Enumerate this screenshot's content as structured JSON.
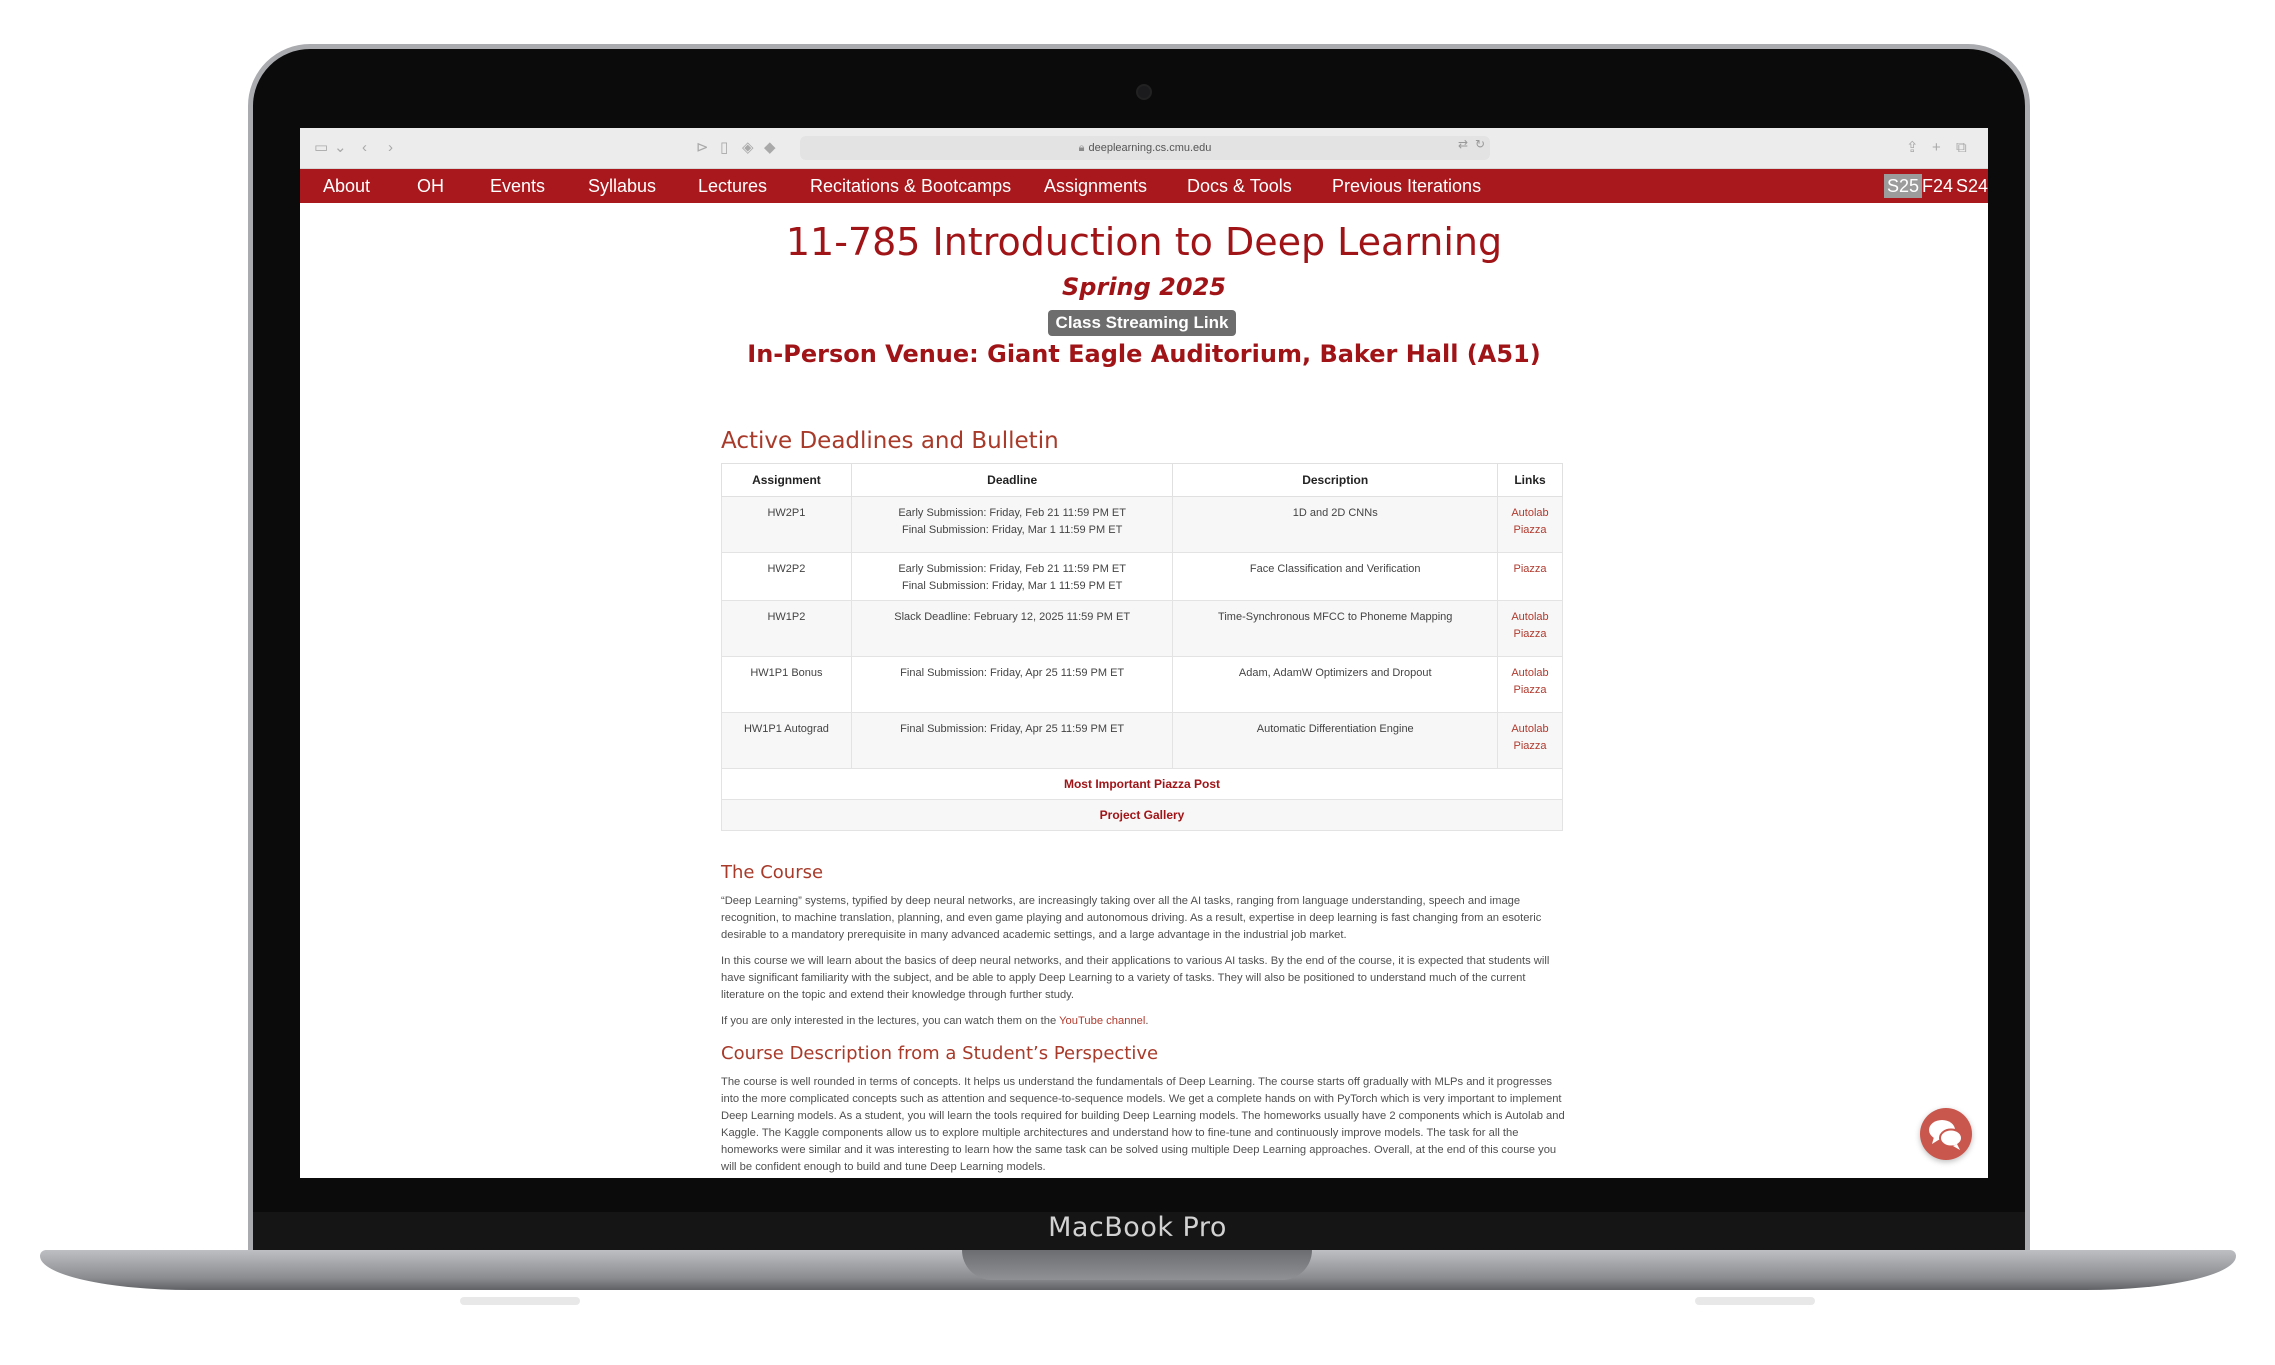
{
  "device": {
    "label": "MacBook Pro"
  },
  "browser": {
    "url": "deeplearning.cs.cmu.edu"
  },
  "nav": {
    "items": [
      "About",
      "OH",
      "Events",
      "Syllabus",
      "Lectures",
      "Recitations & Bootcamps",
      "Assignments",
      "Docs & Tools",
      "Previous Iterations"
    ],
    "terms": [
      "S25",
      "F24",
      "S24"
    ],
    "active_term": "S25"
  },
  "header": {
    "title": "11-785 Introduction to Deep Learning",
    "subtitle": "Spring 2025",
    "stream_button": "Class Streaming Link",
    "venue": "In-Person Venue: Giant Eagle Auditorium, Baker Hall (A51)"
  },
  "deadlines": {
    "heading": "Active Deadlines and Bulletin",
    "columns": [
      "Assignment",
      "Deadline",
      "Description",
      "Links"
    ],
    "rows": [
      {
        "assignment": "HW2P1",
        "deadline": [
          "Early Submission: Friday, Feb 21 11:59 PM ET",
          "Final Submission: Friday, Mar 1 11:59 PM ET"
        ],
        "description": "1D and 2D CNNs",
        "links": [
          "Autolab",
          "Piazza"
        ]
      },
      {
        "assignment": "HW2P2",
        "deadline": [
          "Early Submission: Friday, Feb 21 11:59 PM ET",
          "Final Submission: Friday, Mar 1 11:59 PM ET"
        ],
        "description": "Face Classification and Verification",
        "links": [
          "Piazza"
        ]
      },
      {
        "assignment": "HW1P2",
        "deadline": [
          "Slack Deadline: February 12, 2025 11:59 PM ET"
        ],
        "description": "Time-Synchronous MFCC to Phoneme Mapping",
        "links": [
          "Autolab",
          "Piazza"
        ]
      },
      {
        "assignment": "HW1P1 Bonus",
        "deadline": [
          "Final Submission: Friday, Apr 25 11:59 PM ET"
        ],
        "description": "Adam, AdamW Optimizers and Dropout",
        "links": [
          "Autolab",
          "Piazza"
        ]
      },
      {
        "assignment": "HW1P1 Autograd",
        "deadline": [
          "Final Submission: Friday, Apr 25 11:59 PM ET"
        ],
        "description": "Automatic Differentiation Engine",
        "links": [
          "Autolab",
          "Piazza"
        ]
      }
    ],
    "footer_links": [
      "Most Important Piazza Post",
      "Project Gallery"
    ]
  },
  "course": {
    "heading": "The Course",
    "p1": "“Deep Learning” systems, typified by deep neural networks, are increasingly taking over all the AI tasks, ranging from language understanding, speech and image recognition, to machine translation, planning, and even game playing and autonomous driving. As a result, expertise in deep learning is fast changing from an esoteric desirable to a mandatory prerequisite in many advanced academic settings, and a large advantage in the industrial job market.",
    "p2": "In this course we will learn about the basics of deep neural networks, and their applications to various AI tasks. By the end of the course, it is expected that students will have significant familiarity with the subject, and be able to apply Deep Learning to a variety of tasks. They will also be positioned to understand much of the current literature on the topic and extend their knowledge through further study.",
    "p3_prefix": "If you are only interested in the lectures, you can watch them on the ",
    "p3_link": "YouTube channel",
    "p3_suffix": "."
  },
  "student": {
    "heading": "Course Description from a Student’s Perspective",
    "p1": "The course is well rounded in terms of concepts. It helps us understand the fundamentals of Deep Learning. The course starts off gradually with MLPs and it progresses into the more complicated concepts such as attention and sequence-to-sequence models. We get a complete hands on with PyTorch which is very important to implement Deep Learning models. As a student, you will learn the tools required for building Deep Learning models. The homeworks usually have 2 components which is Autolab and Kaggle. The Kaggle components allow us to explore multiple architectures and understand how to fine-tune and continuously improve models. The task for all the homeworks were similar and it was interesting to learn how the same task can be solved using multiple Deep Learning approaches. Overall, at the end of this course you will be confident enough to build and tune Deep Learning models."
  },
  "colors": {
    "brand": "#a8181c",
    "link": "#b03a2e",
    "button_gray": "#6d6d6d"
  }
}
